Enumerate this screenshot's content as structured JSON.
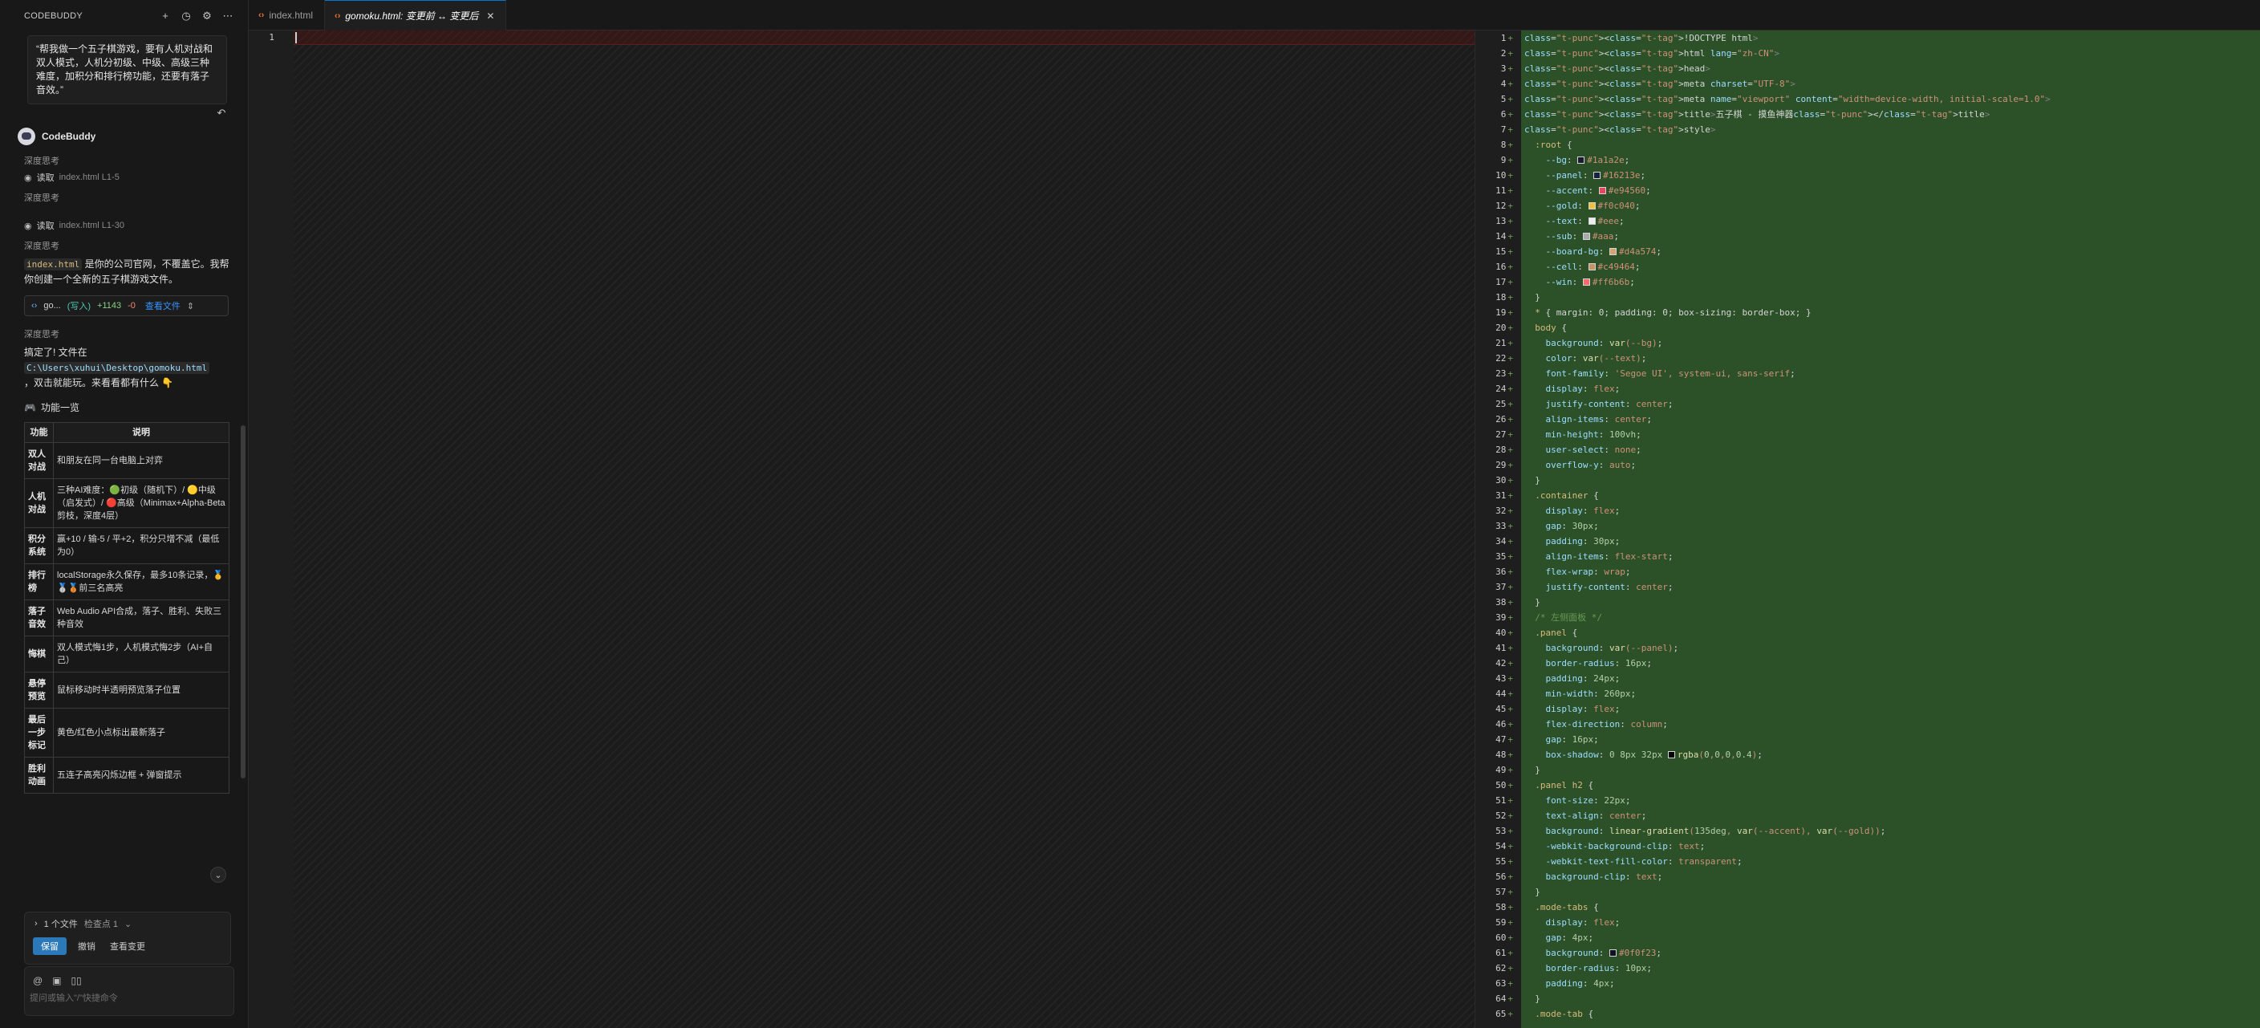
{
  "chat": {
    "title": "CODEBUDDY",
    "user_message": "“帮我做一个五子棋游戏，要有人机对战和双人模式，人机分初级、中级、高级三种难度，加积分和排行榜功能，还要有落子音效。”",
    "assistant_name": "CodeBuddy",
    "thinking_label": "深度思考",
    "read1": {
      "label": "读取",
      "file": "index.html L1-5"
    },
    "read2": {
      "label": "读取",
      "file": "index.html L1-30"
    },
    "para1_code": "index.html",
    "para1_text": " 是你的公司官网，不覆盖它。我帮你创建一个全新的五子棋游戏文件。",
    "file_chip": {
      "name": "go...",
      "write": "(写入)",
      "added": "+1143",
      "removed": "-0",
      "view": "查看文件"
    },
    "done_text_1": "搞定了! 文件在",
    "done_path": "C:\\Users\\xuhui\\Desktop\\gomoku.html",
    "done_text_2": "，双击就能玩。来看看都有什么 👇",
    "features_heading": "功能一览",
    "table_headers": [
      "功能",
      "说明"
    ],
    "table_rows": [
      [
        "双人对战",
        "和朋友在同一台电脑上对弈"
      ],
      [
        "人机对战",
        "三种AI难度：🟢初级（随机下）/ 🟡中级（启发式）/ 🔴高级（Minimax+Alpha-Beta剪枝，深度4层）"
      ],
      [
        "积分系统",
        "赢+10 / 输-5 / 平+2，积分只增不减（最低为0）"
      ],
      [
        "排行榜",
        "localStorage永久保存，最多10条记录，🥇🥈🥉前三名高亮"
      ],
      [
        "落子音效",
        "Web Audio API合成，落子、胜利、失败三种音效"
      ],
      [
        "悔棋",
        "双人模式悔1步，人机模式悔2步（AI+自己）"
      ],
      [
        "悬停预览",
        "鼠标移动时半透明预览落子位置"
      ],
      [
        "最后一步标记",
        "黄色/红色小点标出最新落子"
      ],
      [
        "胜利动画",
        "五连子高亮闪烁边框 + 弹窗提示"
      ]
    ],
    "changes": {
      "files": "1 个文件",
      "checkpoint": "检查点 1",
      "keep": "保留",
      "undo": "撤销",
      "view": "查看变更"
    },
    "input_placeholder": "提问或输入\"/\"快捷命令"
  },
  "tabs": [
    {
      "label": "index.html",
      "active": false
    },
    {
      "label": "gomoku.html: 变更前 ↔ 变更后",
      "active": true
    }
  ],
  "left_pane": {
    "line_numbers": [
      "1"
    ]
  },
  "right_pane": {
    "line_numbers": [
      "1",
      "2",
      "3",
      "4",
      "5",
      "6",
      "7",
      "8",
      "9",
      "10",
      "11",
      "12",
      "13",
      "14",
      "15",
      "16",
      "17",
      "18",
      "19",
      "20",
      "21",
      "22",
      "23",
      "24",
      "25",
      "26",
      "27",
      "28",
      "29",
      "30",
      "31",
      "32",
      "33",
      "34",
      "35",
      "36",
      "37",
      "38",
      "39",
      "40",
      "41",
      "42",
      "43",
      "44",
      "45",
      "46",
      "47",
      "48",
      "49",
      "50",
      "51",
      "52",
      "53",
      "54",
      "55",
      "56",
      "57",
      "58",
      "59",
      "60",
      "61",
      "62",
      "63",
      "64",
      "65"
    ],
    "code_lines": [
      "<!DOCTYPE html>",
      "<html lang=\"zh-CN\">",
      "<head>",
      "<meta charset=\"UTF-8\">",
      "<meta name=\"viewport\" content=\"width=device-width, initial-scale=1.0\">",
      "<title>五子棋 - 摸鱼神器</title>",
      "<style>",
      "  :root {",
      "    --bg: #1a1a2e;",
      "    --panel: #16213e;",
      "    --accent: #e94560;",
      "    --gold: #f0c040;",
      "    --text: #eee;",
      "    --sub: #aaa;",
      "    --board-bg: #d4a574;",
      "    --cell: #c49464;",
      "    --win: #ff6b6b;",
      "  }",
      "  * { margin: 0; padding: 0; box-sizing: border-box; }",
      "  body {",
      "    background: var(--bg);",
      "    color: var(--text);",
      "    font-family: 'Segoe UI', system-ui, sans-serif;",
      "    display: flex;",
      "    justify-content: center;",
      "    align-items: center;",
      "    min-height: 100vh;",
      "    user-select: none;",
      "    overflow-y: auto;",
      "  }",
      "  .container {",
      "    display: flex;",
      "    gap: 30px;",
      "    padding: 30px;",
      "    align-items: flex-start;",
      "    flex-wrap: wrap;",
      "    justify-content: center;",
      "  }",
      "  /* 左侧面板 */",
      "  .panel {",
      "    background: var(--panel);",
      "    border-radius: 16px;",
      "    padding: 24px;",
      "    min-width: 260px;",
      "    display: flex;",
      "    flex-direction: column;",
      "    gap: 16px;",
      "    box-shadow: 0 8px 32px rgba(0,0,0,0.4);",
      "  }",
      "  .panel h2 {",
      "    font-size: 22px;",
      "    text-align: center;",
      "    background: linear-gradient(135deg, var(--accent), var(--gold));",
      "    -webkit-background-clip: text;",
      "    -webkit-text-fill-color: transparent;",
      "    background-clip: text;",
      "  }",
      "  .mode-tabs {",
      "    display: flex;",
      "    gap: 4px;",
      "    background: #0f0f23;",
      "    border-radius: 10px;",
      "    padding: 4px;",
      "  }",
      "  .mode-tab {"
    ],
    "swatches": {
      "9": "#1a1a2e",
      "10": "#16213e",
      "11": "#e94560",
      "12": "#f0c040",
      "13": "#eee",
      "14": "#aaa",
      "15": "#d4a574",
      "16": "#c49464",
      "17": "#ff6b6b",
      "48": "#000000",
      "61": "#0f0f23"
    }
  }
}
